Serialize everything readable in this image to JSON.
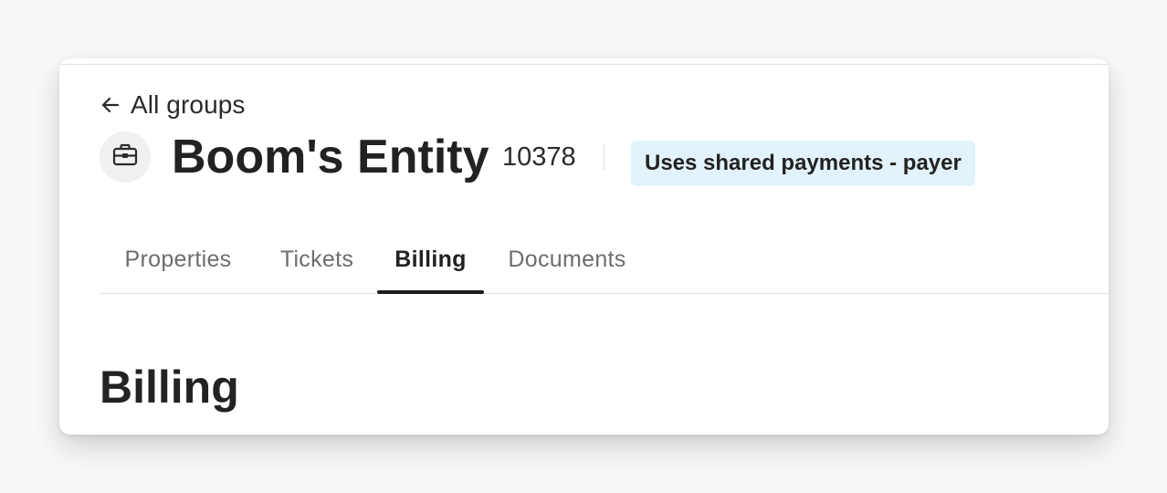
{
  "header": {
    "back_label": "All groups",
    "entity_name": "Boom's Entity",
    "entity_id": "10378",
    "badge_label": "Uses shared payments - payer",
    "avatar_icon": "briefcase-icon"
  },
  "tabs": [
    {
      "label": "Properties",
      "active": false
    },
    {
      "label": "Tickets",
      "active": false
    },
    {
      "label": "Billing",
      "active": true
    },
    {
      "label": "Documents",
      "active": false
    }
  ],
  "section": {
    "title": "Billing"
  },
  "colors": {
    "badge_bg": "#e2f3fc",
    "active_tab_underline": "#1d1d1d",
    "inactive_tab_text": "#6d6d6d"
  }
}
